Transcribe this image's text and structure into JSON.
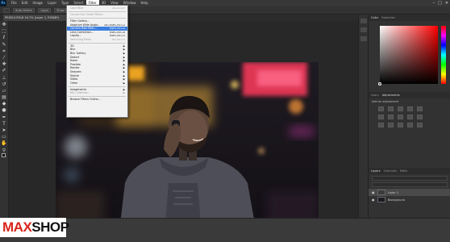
{
  "app": {
    "logo": "Ps"
  },
  "menubar": [
    "File",
    "Edit",
    "Image",
    "Layer",
    "Type",
    "Select",
    "Filter",
    "3D",
    "View",
    "Window",
    "Help"
  ],
  "menubar_active_index": 6,
  "window_controls": [
    "–",
    "□",
    "✕"
  ],
  "options_bar": [
    "Auto-Select:",
    "Layer",
    "Show Transform Controls"
  ],
  "document": {
    "tab_title": "PEXELS-PIX-B 16.7% (Layer 1, RGB/8*)"
  },
  "filter_menu": [
    {
      "label": "Last Filter",
      "shortcut": "Alt+Ctrl+F",
      "disabled": true
    },
    {
      "sep": true
    },
    {
      "label": "Convert for Smart Filters",
      "disabled": true
    },
    {
      "sep": true
    },
    {
      "label": "Filter Gallery..."
    },
    {
      "label": "Adaptive Wide Angle...",
      "shortcut": "Alt+Shift+Ctrl+A"
    },
    {
      "label": "Camera Raw Filter...",
      "shortcut": "Shift+Ctrl+A",
      "highlight": true
    },
    {
      "label": "Lens Correction...",
      "shortcut": "Shift+Ctrl+R"
    },
    {
      "label": "Liquify...",
      "shortcut": "Shift+Ctrl+X"
    },
    {
      "label": "Vanishing Point...",
      "shortcut": "Alt+Ctrl+V",
      "disabled": true
    },
    {
      "sep": true
    },
    {
      "label": "3D",
      "submenu": true
    },
    {
      "label": "Blur",
      "submenu": true
    },
    {
      "label": "Blur Gallery",
      "submenu": true
    },
    {
      "label": "Distort",
      "submenu": true
    },
    {
      "label": "Noise",
      "submenu": true
    },
    {
      "label": "Pixelate",
      "submenu": true
    },
    {
      "label": "Render",
      "submenu": true
    },
    {
      "label": "Sharpen",
      "submenu": true
    },
    {
      "label": "Stylize",
      "submenu": true
    },
    {
      "label": "Video",
      "submenu": true
    },
    {
      "label": "Other",
      "submenu": true
    },
    {
      "sep": true
    },
    {
      "label": "Imagenomic",
      "submenu": true
    },
    {
      "label": "Nik Collection",
      "submenu": true,
      "disabled": true
    },
    {
      "sep": true
    },
    {
      "label": "Browse Filters Online..."
    }
  ],
  "panels": {
    "color_tabs": [
      "Color",
      "Swatches"
    ],
    "adjust_tabs": [
      "Learn",
      "Adjustments"
    ],
    "adjust_label": "Add an adjustment",
    "layers_tabs": [
      "Layers",
      "Channels",
      "Paths"
    ],
    "layers": [
      {
        "name": "Layer 1",
        "selected": true
      },
      {
        "name": "Background",
        "selected": false
      }
    ]
  },
  "watermark": {
    "part1": "MAX",
    "part2": "SHOP"
  }
}
